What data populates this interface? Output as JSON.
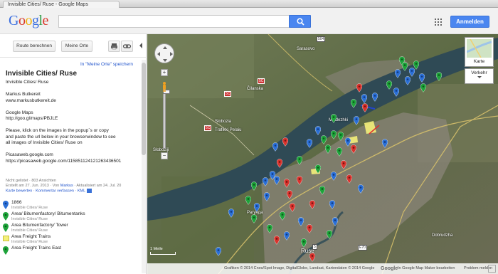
{
  "browser": {
    "tab_title": "Invisible Cities/ Ruse - Google Maps"
  },
  "header": {
    "logo": [
      "G",
      "o",
      "o",
      "g",
      "l",
      "e"
    ],
    "search_placeholder": "",
    "signin_label": "Anmelden"
  },
  "panel": {
    "route_button": "Route berechnen",
    "myplaces_button": "Meine Orte",
    "save_link": "In \"Meine Orte\" speichern",
    "title": "Invisible Cities/ Ruse",
    "lines": [
      "Invisible Cities/ Ruse",
      "Markus Butkereit\nwww.markusbutkereit.de",
      "Google Maps\nhttp://goo.gl/maps/PBJLE",
      "Please, klick on the images in the popup´s or copy\nand paste the url below in your browserwindow to see\nall images of Invisible Cities/ Ruse on",
      "Picasaweb.google.com\nhttps://picasaweb.google.com/115851124121263436501"
    ],
    "meta_line1": "Nicht gelistet · 803 Ansichten",
    "meta_line2_prefix": "Erstellt am 27. Jun. 2013 · Von",
    "meta_author": "Markus",
    "meta_line2_suffix": " · Aktualisiert am 24. Jul. 20",
    "meta_links": "Karte bewerten · Kommentar verfassen · KML",
    "items": [
      {
        "name": "1866",
        "sub": "Invisible Cities/ Ruse",
        "icon": "blue-pin"
      },
      {
        "name": "Area/ Bitumenfactory/ Bitumentanks",
        "sub": "Invisible Cities/ Ruse",
        "icon": "green-pin"
      },
      {
        "name": "Area Bitumenfactory/ Tower",
        "sub": "Invisible Cities/ Ruse",
        "icon": "green-pin"
      },
      {
        "name": "Area Freight Trains",
        "sub": "Invisible Cities/ Ruse",
        "icon": "yellow-area"
      },
      {
        "name": "Area Freight Trains East",
        "sub": "",
        "icon": "green-pin"
      }
    ]
  },
  "map": {
    "map_type": "Karte",
    "traffic": "Verkehr",
    "scale": "1 Meile",
    "attribution": "Grafiken © 2014 Cnes/Spot Image, DigitalGlobe, Landsat, Kartendaten © 2014 Google",
    "edit_link": "In Google Map Maker bearbeiten",
    "report": "Problem melden",
    "footer_logo": "Google",
    "places": [
      "Sarasovo",
      "Čilanska",
      "Sloboziji",
      "Slobozia",
      "Trafikki Pelaiu",
      "Mladezhki",
      "Ruse",
      "Dobrudzha",
      "Рагунда"
    ],
    "route_numbers": [
      "504",
      "5C",
      "5C",
      "5C",
      "5",
      "E70"
    ]
  },
  "colors": {
    "accent_blue": "#4a86f0",
    "pin_blue": "#2a6fd6",
    "pin_green": "#1ea33a",
    "pin_red": "#d8332d",
    "link": "#2255cc"
  }
}
